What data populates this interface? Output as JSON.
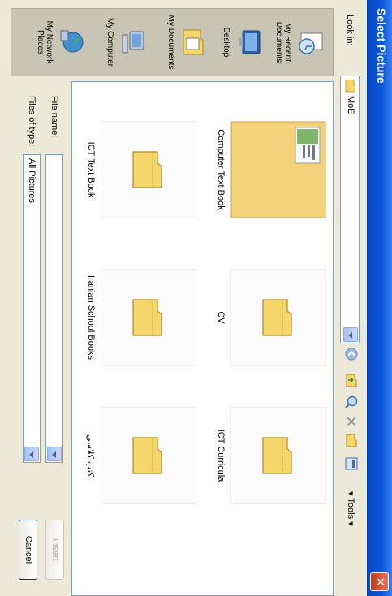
{
  "window": {
    "title": "Select Picture",
    "close_label": "✕"
  },
  "toolbar": {
    "look_in_label": "Look in:",
    "look_in_value": "MoE",
    "tools_label": "Tools"
  },
  "places": [
    {
      "label_line1": "My Recent",
      "label_line2": "Documents",
      "icon": "recent-documents-icon"
    },
    {
      "label_line1": "Desktop",
      "label_line2": "",
      "icon": "desktop-icon"
    },
    {
      "label_line1": "My Documents",
      "label_line2": "",
      "icon": "my-documents-icon"
    },
    {
      "label_line1": "My Computer",
      "label_line2": "",
      "icon": "my-computer-icon"
    },
    {
      "label_line1": "My Network",
      "label_line2": "Places",
      "icon": "network-places-icon"
    }
  ],
  "folders": [
    {
      "label": "Computer Text Book"
    },
    {
      "label": "CV"
    },
    {
      "label": "ICT Curricula"
    },
    {
      "label": "ICT Text Book"
    },
    {
      "label": "Iranian School Books"
    },
    {
      "label": "کتب کلاسی"
    }
  ],
  "bottom": {
    "file_name_label": "File name:",
    "file_name_value": "",
    "file_type_label": "Files of type:",
    "file_type_value": "All Pictures",
    "insert_label": "Insert",
    "cancel_label": "Cancel"
  },
  "colors": {
    "titlebar": "#0a58d8",
    "dialog_bg": "#ece9d8",
    "folder": "#f5d66b"
  }
}
